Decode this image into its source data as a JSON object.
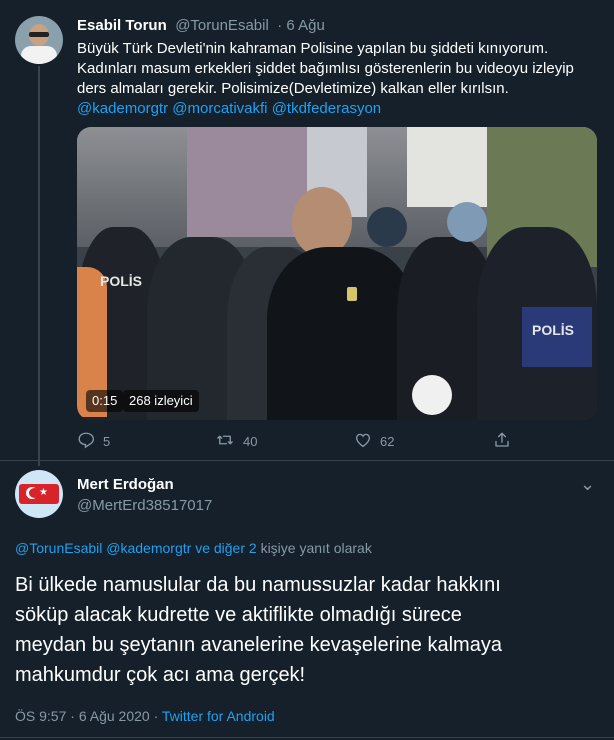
{
  "tweet1": {
    "name": "Esabil Torun",
    "handle": "@TorunEsabil",
    "time": "· 6 Ağu",
    "text_lines": [
      "Büyük Türk Devleti'nin kahraman Polisine yapılan bu şiddeti kınıyorum.",
      "Kadınları masum erkekleri şiddet bağımlısı gösterenlerin bu videoyu izleyip",
      "ders almaları gerekir. Polisimize(Devletimize) kalkan eller kırılsın."
    ],
    "mentions": [
      "@kademorgtr",
      "@morcativakfi",
      "@tkdfederasyon"
    ],
    "video": {
      "duration": "0:15",
      "views": "268 izleyici",
      "police_label_left": "POLİS",
      "police_label_right": "POLİS"
    },
    "actions": {
      "reply_count": "5",
      "retweet_count": "40",
      "like_count": "62"
    },
    "icons": {
      "reply": "reply-icon",
      "retweet": "retweet-icon",
      "like": "heart-icon",
      "share": "share-icon"
    }
  },
  "tweet2": {
    "name": "Mert Erdoğan",
    "handle": "@MertErd38517017",
    "more": "⌄",
    "reply_to": {
      "mention1": "@TorunEsabil",
      "mention2": "@kademorgtr",
      "and_others": "ve diğer 2",
      "suffix": "kişiye yanıt olarak"
    },
    "text_lines": [
      "Bi ülkede namuslular da bu namussuzlar kadar hakkını",
      "söküp alacak kudrette ve aktiflikte olmadığı sürece",
      "meydan bu şeytanın avanelerine kevaşelerine kalmaya",
      "mahkumdur çok acı ama gerçek!"
    ],
    "time": "ÖS 9:57",
    "date": "6 Ağu 2020",
    "source": "Twitter for Android"
  },
  "colors": {
    "background": "#15202b",
    "accent": "#1da1f2",
    "secondary_text": "#8899a6",
    "divider": "#38444d"
  }
}
